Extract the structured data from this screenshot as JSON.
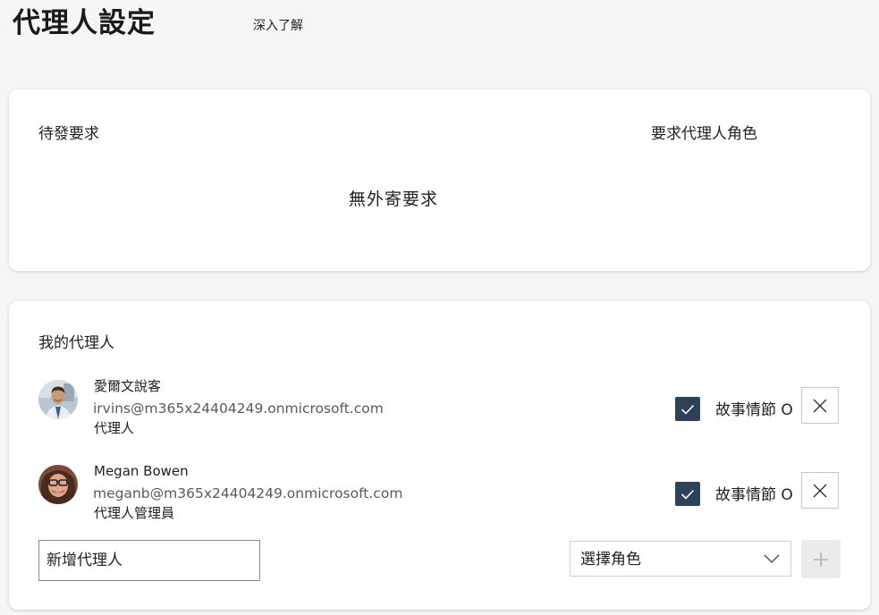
{
  "header": {
    "title": "代理人設定",
    "learn_more": "深入了解"
  },
  "pending": {
    "label": "待發要求",
    "request_role_link": "要求代理人角色",
    "empty_text": "無外寄要求"
  },
  "delegates": {
    "label": "我的代理人",
    "items": [
      {
        "name": "愛爾文說客",
        "email": "irvins@m365x24404249.onmicrosoft.com",
        "role": "代理人",
        "checkbox_label": "故事情節 O",
        "checked": true
      },
      {
        "name": "Megan Bowen",
        "email": "meganb@m365x24404249.onmicrosoft.com",
        "role": "代理人管理員",
        "checkbox_label": "故事情節 O",
        "checked": true
      }
    ],
    "add_input_placeholder": "新增代理人",
    "role_select_value": "選擇角色"
  },
  "colors": {
    "page_bg": "#f8f6f5",
    "checkbox_fill": "#2e4257",
    "add_button_bg": "#ebebeb"
  },
  "icons": {
    "checkbox": "check-icon",
    "remove": "close-icon",
    "dropdown": "chevron-down-icon",
    "add": "plus-icon"
  }
}
